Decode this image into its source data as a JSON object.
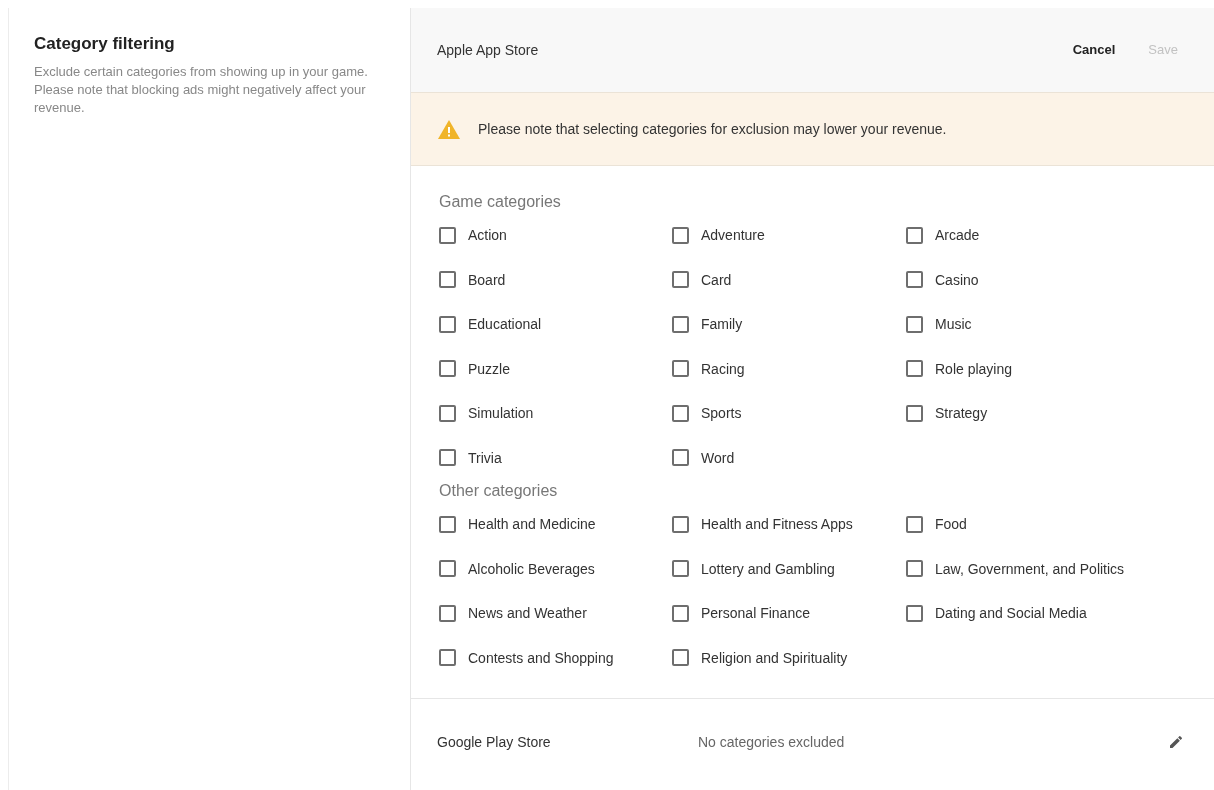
{
  "intro": {
    "title": "Category filtering",
    "description": "Exclude certain categories from showing up in your game. Please note that blocking ads might negatively affect your revenue."
  },
  "stores": [
    {
      "kind": "editing",
      "name": "Apple App Store",
      "actions": [
        {
          "label": "Cancel",
          "disabled": false
        },
        {
          "label": "Save",
          "disabled": true
        }
      ],
      "warning": "Please note that selecting categories for exclusion may lower your revenue.",
      "groups": [
        {
          "title": "Game categories",
          "items": [
            {
              "label": "Action",
              "checked": false
            },
            {
              "label": "Adventure",
              "checked": false
            },
            {
              "label": "Arcade",
              "checked": false
            },
            {
              "label": "Board",
              "checked": false
            },
            {
              "label": "Card",
              "checked": false
            },
            {
              "label": "Casino",
              "checked": false
            },
            {
              "label": "Educational",
              "checked": false
            },
            {
              "label": "Family",
              "checked": false
            },
            {
              "label": "Music",
              "checked": false
            },
            {
              "label": "Puzzle",
              "checked": false
            },
            {
              "label": "Racing",
              "checked": false
            },
            {
              "label": "Role playing",
              "checked": false
            },
            {
              "label": "Simulation",
              "checked": false
            },
            {
              "label": "Sports",
              "checked": false
            },
            {
              "label": "Strategy",
              "checked": false
            },
            {
              "label": "Trivia",
              "checked": false
            },
            {
              "label": "Word",
              "checked": false
            }
          ]
        },
        {
          "title": "Other categories",
          "items": [
            {
              "label": "Health and Medicine",
              "checked": false
            },
            {
              "label": "Health and Fitness Apps",
              "checked": false
            },
            {
              "label": "Food",
              "checked": false
            },
            {
              "label": "Alcoholic Beverages",
              "checked": false
            },
            {
              "label": "Lottery and Gambling",
              "checked": false
            },
            {
              "label": "Law, Government, and Politics",
              "checked": false
            },
            {
              "label": "News and Weather",
              "checked": false
            },
            {
              "label": "Personal Finance",
              "checked": false
            },
            {
              "label": "Dating and Social Media",
              "checked": false
            },
            {
              "label": "Contests and Shopping",
              "checked": false
            },
            {
              "label": "Religion and Spirituality",
              "checked": false
            }
          ]
        }
      ]
    },
    {
      "kind": "summary",
      "name": "Google Play Store",
      "status": "No categories excluded"
    }
  ]
}
